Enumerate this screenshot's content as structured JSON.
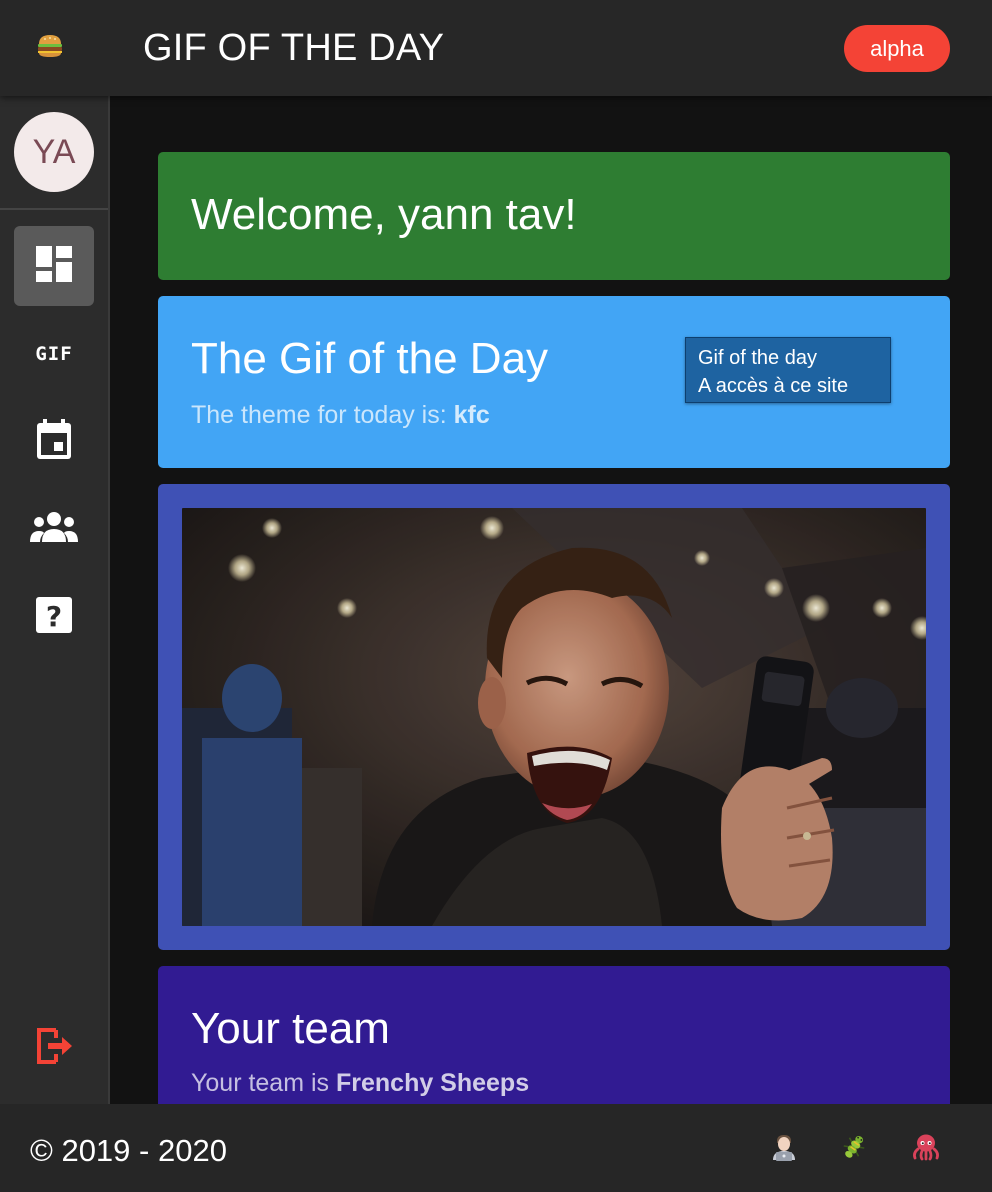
{
  "header": {
    "title": "GIF OF THE DAY",
    "badge": "alpha",
    "badge_color": "#f44336",
    "menu_icon": "burger-icon"
  },
  "sidebar": {
    "avatar_initials": "YA",
    "items": [
      {
        "icon": "dashboard-icon",
        "active": true
      },
      {
        "icon": "gif-icon",
        "label": "GIF"
      },
      {
        "icon": "calendar-icon"
      },
      {
        "icon": "group-icon"
      },
      {
        "icon": "help-icon"
      },
      {
        "icon": "logout-icon",
        "color": "#f44336"
      }
    ]
  },
  "cards": {
    "welcome": {
      "title": "Welcome, yann tav!",
      "color": "#2e7d32"
    },
    "gif_of_day": {
      "title": "The Gif of the Day",
      "subtitle_prefix": "The theme for today is: ",
      "theme": "kfc",
      "color": "#42a5f5",
      "tooltip_line1": "Gif of the day",
      "tooltip_line2": "A accès à ce site"
    },
    "gif_image": {
      "color": "#3f51b5",
      "alt": "laughing man holding a phone"
    },
    "team": {
      "title": "Your team",
      "subtitle_prefix": "Your team is ",
      "team_name": "Frenchy Sheeps",
      "color": "#311b92"
    }
  },
  "footer": {
    "copyright": "© 2019 - 2020",
    "icons": [
      "technologist-icon",
      "bug-icon",
      "octopus-icon"
    ]
  }
}
